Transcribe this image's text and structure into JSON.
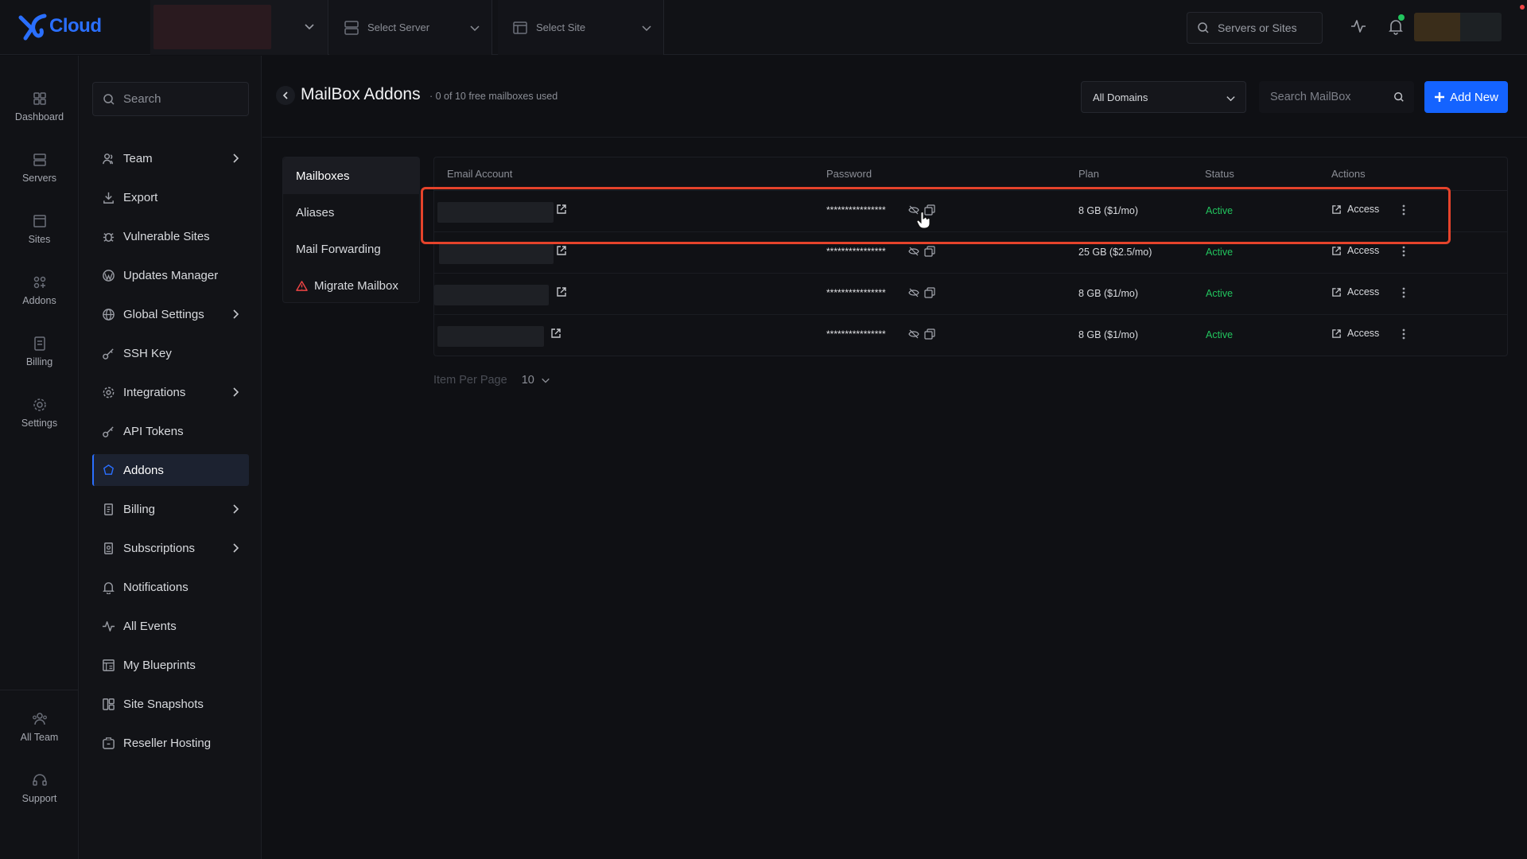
{
  "app": {
    "brand": "Cloud"
  },
  "topbar": {
    "server_select": "Select Server",
    "site_select": "Select Site",
    "search_placeholder": "Servers or Sites"
  },
  "rail": {
    "items": [
      {
        "label": "Dashboard",
        "icon": "dashboard-icon"
      },
      {
        "label": "Servers",
        "icon": "servers-icon"
      },
      {
        "label": "Sites",
        "icon": "sites-icon"
      },
      {
        "label": "Addons",
        "icon": "addons-icon"
      },
      {
        "label": "Billing",
        "icon": "billing-icon"
      },
      {
        "label": "Settings",
        "icon": "settings-icon"
      }
    ],
    "bottom": [
      {
        "label": "All Team",
        "icon": "team-icon"
      },
      {
        "label": "Support",
        "icon": "support-icon"
      }
    ]
  },
  "sidebar": {
    "search_placeholder": "Search",
    "items": [
      {
        "label": "Team",
        "icon": "team-icon",
        "expandable": true
      },
      {
        "label": "Export",
        "icon": "export-icon"
      },
      {
        "label": "Vulnerable Sites",
        "icon": "bug-icon"
      },
      {
        "label": "Updates Manager",
        "icon": "wordpress-icon"
      },
      {
        "label": "Global Settings",
        "icon": "globe-icon",
        "expandable": true
      },
      {
        "label": "SSH Key",
        "icon": "key-icon"
      },
      {
        "label": "Integrations",
        "icon": "gear-icon",
        "expandable": true
      },
      {
        "label": "API Tokens",
        "icon": "key-icon"
      },
      {
        "label": "Addons",
        "icon": "addons-icon",
        "active": true
      },
      {
        "label": "Billing",
        "icon": "billing-icon",
        "expandable": true
      },
      {
        "label": "Subscriptions",
        "icon": "subscriptions-icon",
        "expandable": true
      },
      {
        "label": "Notifications",
        "icon": "bell-icon"
      },
      {
        "label": "All Events",
        "icon": "activity-icon"
      },
      {
        "label": "My Blueprints",
        "icon": "blueprint-icon"
      },
      {
        "label": "Site Snapshots",
        "icon": "snapshot-icon"
      },
      {
        "label": "Reseller Hosting",
        "icon": "reseller-icon"
      }
    ]
  },
  "main": {
    "title": "MailBox Addons",
    "subtitle": "· 0 of 10 free mailboxes used",
    "domain_filter": "All Domains",
    "search_placeholder": "Search MailBox",
    "add_button": "Add New",
    "tabs": [
      {
        "label": "Mailboxes",
        "active": true
      },
      {
        "label": "Aliases"
      },
      {
        "label": "Mail Forwarding"
      },
      {
        "label": "Migrate Mailbox",
        "icon": "warning-icon"
      }
    ],
    "table": {
      "headers": {
        "email": "Email Account",
        "password": "Password",
        "plan": "Plan",
        "status": "Status",
        "actions": "Actions"
      },
      "rows": [
        {
          "password": "****************",
          "plan": "8 GB ($1/mo)",
          "status": "Active",
          "action": "Access"
        },
        {
          "password": "****************",
          "plan": "25 GB ($2.5/mo)",
          "status": "Active",
          "action": "Access"
        },
        {
          "password": "****************",
          "plan": "8 GB ($1/mo)",
          "status": "Active",
          "action": "Access"
        },
        {
          "password": "****************",
          "plan": "8 GB ($1/mo)",
          "status": "Active",
          "action": "Access"
        }
      ]
    },
    "pager": {
      "label": "Item Per Page",
      "value": "10"
    }
  },
  "colors": {
    "accent": "#1463ff",
    "active": "#22c55e",
    "highlight": "#e5432b"
  }
}
